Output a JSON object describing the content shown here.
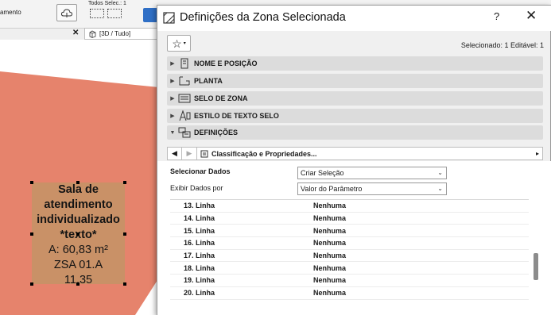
{
  "background_app": {
    "tool_label": "amento",
    "selection_label": "Todos Selec.: 1",
    "view_tab": "[3D / Tudo]",
    "zone_stamp": {
      "bold_lines": [
        "Sala de",
        "atendimento",
        "individualizado",
        "*texto*"
      ],
      "area": "A: 60,83 m²",
      "code": "ZSA 01.A",
      "height": "11,35"
    }
  },
  "dialog": {
    "title": "Definições da Zona Selecionada",
    "help": "?",
    "close": "✕",
    "selected_info": "Selecionado: 1 Editável: 1",
    "sections": [
      {
        "label": "NOME E POSIÇÃO",
        "icon": "name-position-icon",
        "expanded": false
      },
      {
        "label": "PLANTA",
        "icon": "floor-plan-icon",
        "expanded": false
      },
      {
        "label": "SELO DE ZONA",
        "icon": "zone-stamp-icon",
        "expanded": false
      },
      {
        "label": "ESTILO DE TEXTO SELO",
        "icon": "text-style-icon",
        "expanded": false
      },
      {
        "label": "DEFINIÇÕES",
        "icon": "settings-icon",
        "expanded": true
      }
    ],
    "category_nav": "Classificação e Propriedades...",
    "select_data_label": "Selecionar Dados",
    "select_data_value": "Criar Seleção",
    "display_by_label": "Exibir Dados por",
    "display_by_value": "Valor do Parâmetro",
    "rows": [
      {
        "name": "13. Linha",
        "value": "Nenhuma"
      },
      {
        "name": "14. Linha",
        "value": "Nenhuma"
      },
      {
        "name": "15. Linha",
        "value": "Nenhuma"
      },
      {
        "name": "16. Linha",
        "value": "Nenhuma"
      },
      {
        "name": "17. Linha",
        "value": "Nenhuma"
      },
      {
        "name": "18. Linha",
        "value": "Nenhuma"
      },
      {
        "name": "19. Linha",
        "value": "Nenhuma"
      },
      {
        "name": "20. Linha",
        "value": "Nenhuma"
      }
    ]
  }
}
